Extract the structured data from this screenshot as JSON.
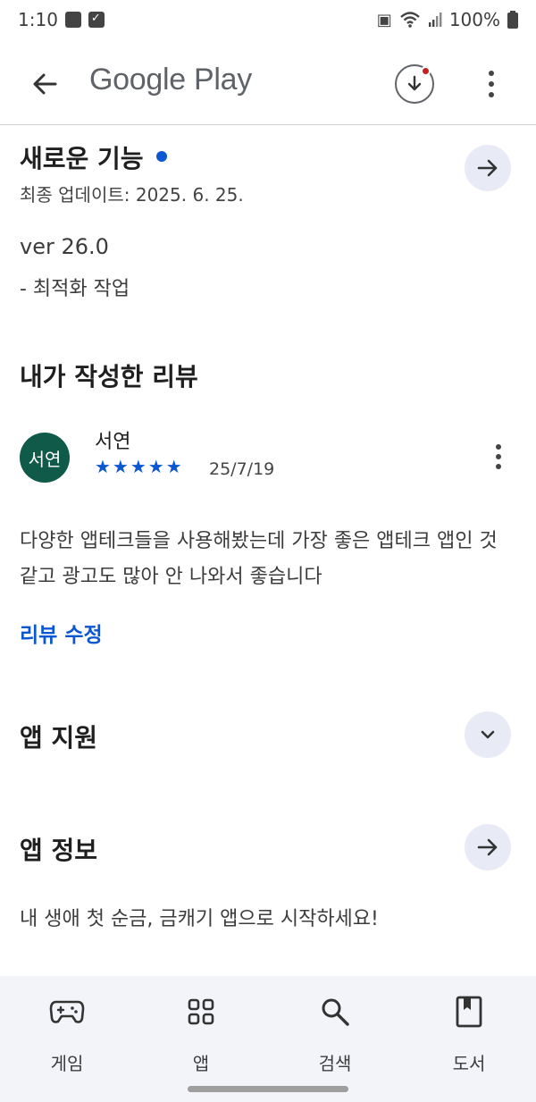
{
  "status_bar": {
    "time": "1:10",
    "battery": "100%"
  },
  "app_bar": {
    "title": "Google Play"
  },
  "whats_new": {
    "title": "새로운 기능",
    "last_updated": "최종 업데이트: 2025. 6. 25.",
    "version": "ver 26.0",
    "notes": "- 최적화 작업"
  },
  "my_review": {
    "title": "내가 작성한 리뷰",
    "avatar_text": "서연",
    "reviewer": "서연",
    "rating": 5,
    "stars_text": "★★★★★",
    "date": "25/7/19",
    "body": "다양한 앱테크들을 사용해봤는데 가장 좋은 앱테크 앱인 것 같고 광고도 많아 안 나와서 좋습니다",
    "edit_label": "리뷰 수정"
  },
  "app_support": {
    "title": "앱 지원"
  },
  "app_info": {
    "title": "앱 정보",
    "description": "내 생애 첫 순금, 금캐기 앱으로 시작하세요!"
  },
  "bottom_nav": {
    "items": [
      {
        "label": "게임",
        "icon": "gamepad-icon"
      },
      {
        "label": "앱",
        "icon": "apps-grid-icon"
      },
      {
        "label": "검색",
        "icon": "search-icon"
      },
      {
        "label": "도서",
        "icon": "book-icon"
      }
    ]
  },
  "colors": {
    "accent": "#0b57d0",
    "avatar_bg": "#0f5a48",
    "nav_bg": "#f2f4fa",
    "round_button_bg": "#e8ebf6"
  }
}
